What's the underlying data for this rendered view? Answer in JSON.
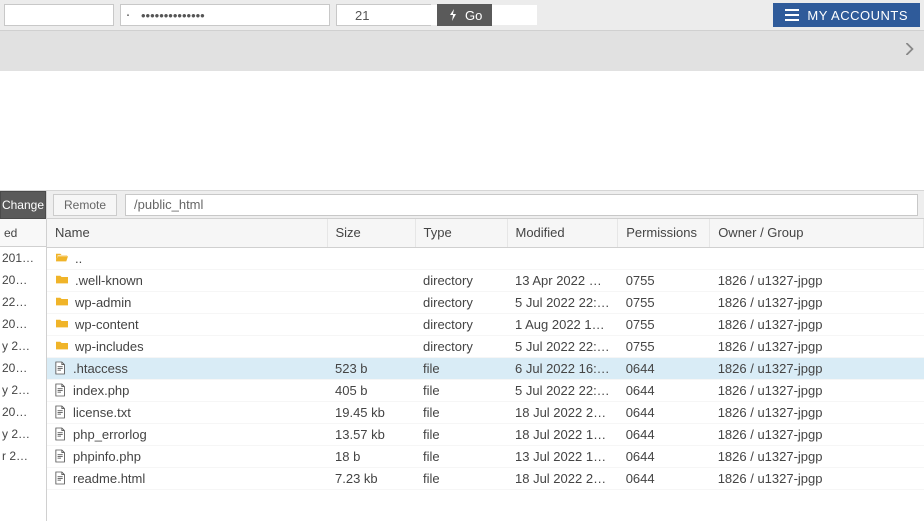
{
  "topbar": {
    "host_value": "",
    "password_mask": "••••••••••••••",
    "port_value": "21",
    "go_label": "Go",
    "accounts_label": "MY ACCOUNTS"
  },
  "left": {
    "change_label": "Change",
    "header": "ed",
    "items": [
      " 201…",
      " 20…",
      "22…",
      " 20…",
      "y 2…",
      " 20…",
      "y 2…",
      " 20…",
      "y 2…",
      "r 2…"
    ]
  },
  "remote": {
    "tab_label": "Remote",
    "path": "/public_html"
  },
  "columns": {
    "name": "Name",
    "size": "Size",
    "type": "Type",
    "modified": "Modified",
    "permissions": "Permissions",
    "owner": "Owner / Group"
  },
  "rows": [
    {
      "icon": "folder-open",
      "name": "..",
      "size": "",
      "type": "",
      "modified": "",
      "perm": "",
      "owner": "",
      "sel": false
    },
    {
      "icon": "folder",
      "name": ".well-known",
      "size": "",
      "type": "directory",
      "modified": "13 Apr 2022 …",
      "perm": "0755",
      "owner": "1826 / u1327-jpgp",
      "sel": false
    },
    {
      "icon": "folder",
      "name": "wp-admin",
      "size": "",
      "type": "directory",
      "modified": "5 Jul 2022 22:…",
      "perm": "0755",
      "owner": "1826 / u1327-jpgp",
      "sel": false
    },
    {
      "icon": "folder",
      "name": "wp-content",
      "size": "",
      "type": "directory",
      "modified": "1 Aug 2022 1…",
      "perm": "0755",
      "owner": "1826 / u1327-jpgp",
      "sel": false
    },
    {
      "icon": "folder",
      "name": "wp-includes",
      "size": "",
      "type": "directory",
      "modified": "5 Jul 2022 22:…",
      "perm": "0755",
      "owner": "1826 / u1327-jpgp",
      "sel": false
    },
    {
      "icon": "file",
      "name": ".htaccess",
      "size": "523 b",
      "type": "file",
      "modified": "6 Jul 2022 16:…",
      "perm": "0644",
      "owner": "1826 / u1327-jpgp",
      "sel": true
    },
    {
      "icon": "file",
      "name": "index.php",
      "size": "405 b",
      "type": "file",
      "modified": "5 Jul 2022 22:…",
      "perm": "0644",
      "owner": "1826 / u1327-jpgp",
      "sel": false
    },
    {
      "icon": "file",
      "name": "license.txt",
      "size": "19.45 kb",
      "type": "file",
      "modified": "18 Jul 2022 2…",
      "perm": "0644",
      "owner": "1826 / u1327-jpgp",
      "sel": false
    },
    {
      "icon": "file",
      "name": "php_errorlog",
      "size": "13.57 kb",
      "type": "file",
      "modified": "18 Jul 2022 1…",
      "perm": "0644",
      "owner": "1826 / u1327-jpgp",
      "sel": false
    },
    {
      "icon": "file",
      "name": "phpinfo.php",
      "size": "18 b",
      "type": "file",
      "modified": "13 Jul 2022 1…",
      "perm": "0644",
      "owner": "1826 / u1327-jpgp",
      "sel": false
    },
    {
      "icon": "file",
      "name": "readme.html",
      "size": "7.23 kb",
      "type": "file",
      "modified": "18 Jul 2022 2…",
      "perm": "0644",
      "owner": "1826 / u1327-jpgp",
      "sel": false
    }
  ]
}
